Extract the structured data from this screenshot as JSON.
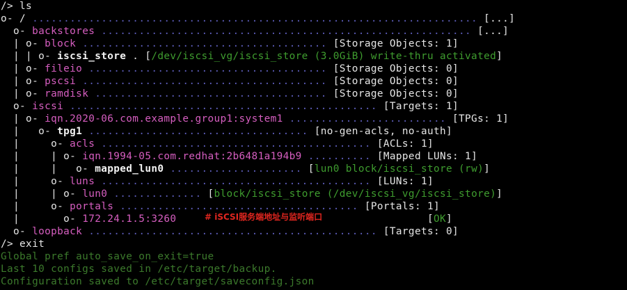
{
  "terminal": {
    "lines": [
      {
        "segments": [
          {
            "t": "/> ls",
            "c": "w"
          }
        ]
      },
      {
        "segments": [
          {
            "t": "o- / ",
            "c": "w"
          },
          {
            "t": "....................................................................... ",
            "c": "d"
          },
          {
            "t": "[...]",
            "c": "w"
          }
        ]
      },
      {
        "segments": [
          {
            "t": "  o- ",
            "c": "w"
          },
          {
            "t": "backstores",
            "c": "p"
          },
          {
            "t": " ........................................................... ",
            "c": "d"
          },
          {
            "t": "[...]",
            "c": "w"
          }
        ]
      },
      {
        "segments": [
          {
            "t": "  | o- ",
            "c": "w"
          },
          {
            "t": "block",
            "c": "p"
          },
          {
            "t": " ....................................... ",
            "c": "d"
          },
          {
            "t": "[Storage Objects: 1]",
            "c": "w"
          }
        ]
      },
      {
        "segments": [
          {
            "t": "  | | o- ",
            "c": "w"
          },
          {
            "t": "iscsi_store",
            "c": "bw"
          },
          {
            "t": " . [",
            "c": "w"
          },
          {
            "t": "/dev/iscsi_vg/iscsi_store (3.0GiB) write-thru activated",
            "c": "g"
          },
          {
            "t": "]",
            "c": "w"
          }
        ]
      },
      {
        "segments": [
          {
            "t": "  | o- ",
            "c": "w"
          },
          {
            "t": "fileio",
            "c": "p"
          },
          {
            "t": " ...................................... ",
            "c": "d"
          },
          {
            "t": "[Storage Objects: 0]",
            "c": "w"
          }
        ]
      },
      {
        "segments": [
          {
            "t": "  | o- ",
            "c": "w"
          },
          {
            "t": "pscsi",
            "c": "p"
          },
          {
            "t": " ....................................... ",
            "c": "d"
          },
          {
            "t": "[Storage Objects: 0]",
            "c": "w"
          }
        ]
      },
      {
        "segments": [
          {
            "t": "  | o- ",
            "c": "w"
          },
          {
            "t": "ramdisk",
            "c": "p"
          },
          {
            "t": " ..................................... ",
            "c": "d"
          },
          {
            "t": "[Storage Objects: 0]",
            "c": "w"
          }
        ]
      },
      {
        "segments": [
          {
            "t": "  o- ",
            "c": "w"
          },
          {
            "t": "iscsi",
            "c": "p"
          },
          {
            "t": " ................................................. ",
            "c": "d"
          },
          {
            "t": "[Targets: 1]",
            "c": "w"
          }
        ]
      },
      {
        "segments": [
          {
            "t": "  | o- ",
            "c": "w"
          },
          {
            "t": "iqn.2020-06.com.example.group1:system1",
            "c": "p"
          },
          {
            "t": " ......................... ",
            "c": "d"
          },
          {
            "t": "[TPGs: 1]",
            "c": "w"
          }
        ]
      },
      {
        "segments": [
          {
            "t": "  |   o- ",
            "c": "w"
          },
          {
            "t": "tpg1",
            "c": "bw"
          },
          {
            "t": " ................................... ",
            "c": "d"
          },
          {
            "t": "[no-gen-acls, no-auth]",
            "c": "w"
          }
        ]
      },
      {
        "segments": [
          {
            "t": "  |     o- ",
            "c": "w"
          },
          {
            "t": "acls",
            "c": "p"
          },
          {
            "t": " ........................................... ",
            "c": "d"
          },
          {
            "t": "[ACLs: 1]",
            "c": "w"
          }
        ]
      },
      {
        "segments": [
          {
            "t": "  |     | o- ",
            "c": "w"
          },
          {
            "t": "iqn.1994-05.com.redhat:2b6481a194b9",
            "c": "p"
          },
          {
            "t": " .......... ",
            "c": "d"
          },
          {
            "t": "[Mapped LUNs: 1]",
            "c": "w"
          }
        ]
      },
      {
        "segments": [
          {
            "t": "  |     |   o- ",
            "c": "w"
          },
          {
            "t": "mapped_lun0",
            "c": "bw"
          },
          {
            "t": " ..................... ",
            "c": "d"
          },
          {
            "t": "[",
            "c": "w"
          },
          {
            "t": "lun0 block/iscsi_store (rw)",
            "c": "g"
          },
          {
            "t": "]",
            "c": "w"
          }
        ]
      },
      {
        "segments": [
          {
            "t": "  |     o- ",
            "c": "w"
          },
          {
            "t": "luns",
            "c": "p"
          },
          {
            "t": " ........................................... ",
            "c": "d"
          },
          {
            "t": "[LUNs: 1]",
            "c": "w"
          }
        ]
      },
      {
        "segments": [
          {
            "t": "  |     | o- ",
            "c": "w"
          },
          {
            "t": "lun0",
            "c": "p"
          },
          {
            "t": " .............. ",
            "c": "d"
          },
          {
            "t": "[",
            "c": "w"
          },
          {
            "t": "block/iscsi_store (/dev/iscsi_vg/iscsi_store)",
            "c": "g"
          },
          {
            "t": "]",
            "c": "w"
          }
        ]
      },
      {
        "segments": [
          {
            "t": "  |     o- ",
            "c": "w"
          },
          {
            "t": "portals",
            "c": "p"
          },
          {
            "t": " ...................................... ",
            "c": "d"
          },
          {
            "t": "[Portals: 1]",
            "c": "w"
          }
        ]
      },
      {
        "segments": [
          {
            "t": "  |       o- ",
            "c": "w"
          },
          {
            "t": "172.24.1.5:3260",
            "c": "p"
          },
          {
            "t": "                                        ",
            "c": "d"
          },
          {
            "t": "[",
            "c": "w"
          },
          {
            "t": "OK",
            "c": "g"
          },
          {
            "t": "]",
            "c": "w"
          }
        ]
      },
      {
        "segments": [
          {
            "t": "  o- ",
            "c": "w"
          },
          {
            "t": "loopback",
            "c": "p"
          },
          {
            "t": " .............................................. ",
            "c": "d"
          },
          {
            "t": "[Targets: 0]",
            "c": "w"
          }
        ]
      },
      {
        "segments": [
          {
            "t": "/> exit",
            "c": "w"
          }
        ]
      },
      {
        "segments": [
          {
            "t": "Global pref auto_save_on_exit=true",
            "c": "gb"
          }
        ]
      },
      {
        "segments": [
          {
            "t": "Last 10 configs saved in /etc/target/backup.",
            "c": "gb"
          }
        ]
      },
      {
        "segments": [
          {
            "t": "Configuration saved to /etc/target/saveconfig.json",
            "c": "gb"
          }
        ]
      }
    ],
    "annotation": "# iSCSI服务端地址与监听端口",
    "colors": {
      "background": "#000000",
      "text": "#e6e6e6",
      "dots": "#5c5cb8",
      "node": "#d65ec0",
      "green": "#3f9d2f",
      "annotation": "#e0261f"
    }
  }
}
